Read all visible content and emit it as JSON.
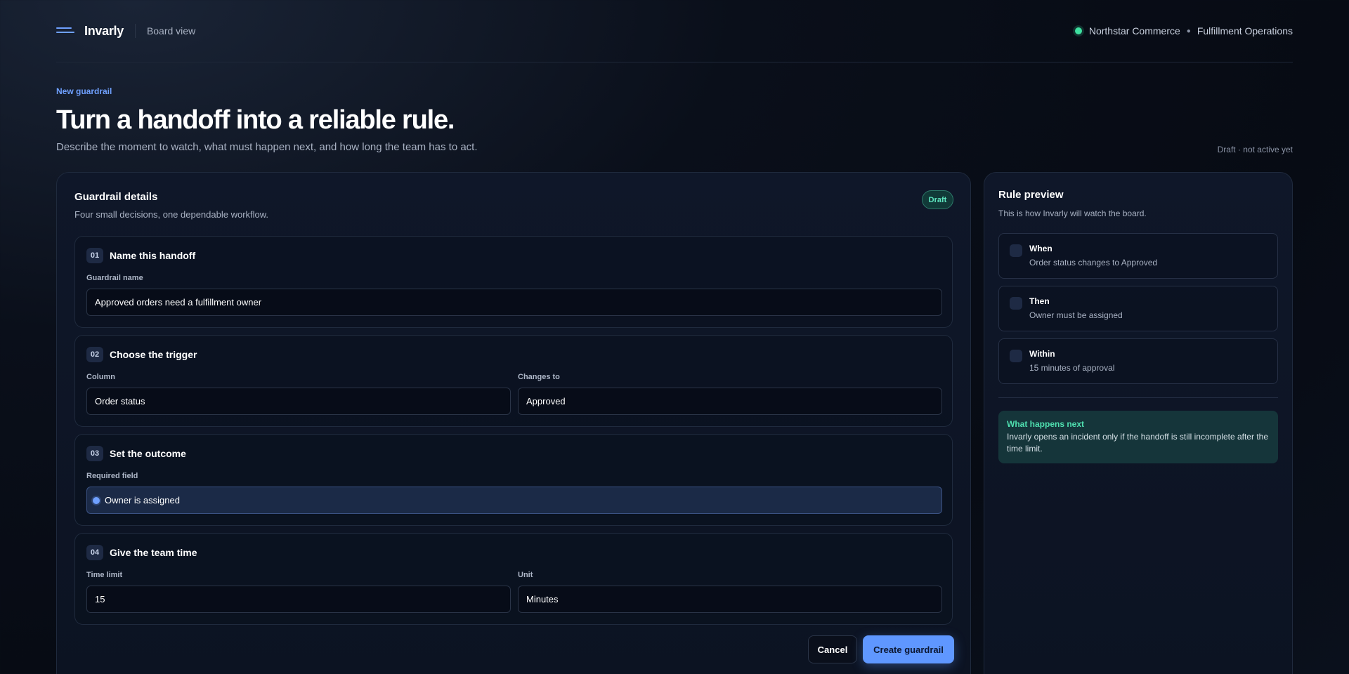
{
  "header": {
    "brand": "Invarly",
    "view": "Board view",
    "workspace": "Northstar Commerce",
    "team": "Fulfillment Operations",
    "status_color": "#3ee0a0"
  },
  "page": {
    "eyebrow": "New guardrail",
    "title": "Turn a handoff into a reliable rule.",
    "subtitle": "Describe the moment to watch, what must happen next, and how long the team has to act.",
    "draft_note": "Draft · not active yet"
  },
  "form": {
    "title": "Guardrail details",
    "subtitle": "Four small decisions, one dependable workflow.",
    "badge": "Draft",
    "sections": [
      {
        "num": "01",
        "title": "Name this handoff",
        "fields": [
          {
            "label": "Guardrail name",
            "value": "Approved orders need a fulfillment owner"
          }
        ]
      },
      {
        "num": "02",
        "title": "Choose the trigger",
        "fields": [
          {
            "label": "Column",
            "value": "Order status"
          },
          {
            "label": "Changes to",
            "value": "Approved"
          }
        ]
      },
      {
        "num": "03",
        "title": "Set the outcome",
        "fields": [
          {
            "label": "Required field",
            "value": "Owner is assigned",
            "selected": true
          }
        ]
      },
      {
        "num": "04",
        "title": "Give the team time",
        "fields": [
          {
            "label": "Time limit",
            "value": "15"
          },
          {
            "label": "Unit",
            "value": "Minutes"
          }
        ]
      }
    ],
    "cancel_label": "Cancel",
    "create_label": "Create guardrail"
  },
  "preview": {
    "title": "Rule preview",
    "subtitle": "This is how Invarly will watch the board.",
    "items": [
      {
        "label": "When",
        "value": "Order status changes to Approved"
      },
      {
        "label": "Then",
        "value": "Owner must be assigned"
      },
      {
        "label": "Within",
        "value": "15 minutes of approval"
      }
    ],
    "callout_title": "What happens next",
    "callout_text": "Invarly opens an incident only if the handoff is still incomplete after the time limit."
  },
  "colors": {
    "accent": "#5f97ff",
    "success": "#4fe0b0",
    "background": "#070b14"
  }
}
